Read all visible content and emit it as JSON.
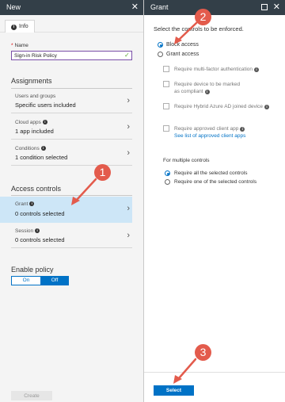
{
  "left_panel": {
    "title": "New",
    "close_glyph": "✕",
    "info_tab": "Info",
    "name_label": "Name",
    "required_mark": "*",
    "name_value": "Sign-in Risk Policy",
    "assignments_title": "Assignments",
    "rows": [
      {
        "label": "Users and groups",
        "value": "Specific users included"
      },
      {
        "label": "Cloud apps",
        "value": "1 app included"
      },
      {
        "label": "Conditions",
        "value": "1 condition selected"
      }
    ],
    "access_title": "Access controls",
    "grant": {
      "label": "Grant",
      "value": "0 controls selected"
    },
    "session": {
      "label": "Session",
      "value": "0 controls selected"
    },
    "enable_title": "Enable policy",
    "toggle": {
      "on": "On",
      "off": "Off",
      "selected": "Off"
    },
    "create_label": "Create"
  },
  "right_panel": {
    "title": "Grant",
    "close_glyph": "✕",
    "instruction": "Select the controls to be enforced.",
    "options": [
      {
        "label": "Block access",
        "selected": true
      },
      {
        "label": "Grant access",
        "selected": false
      }
    ],
    "controls": [
      {
        "label": "Require multi-factor authentication"
      },
      {
        "label": "Require device to be marked as compliant"
      },
      {
        "label": "Require Hybrid Azure AD joined device"
      },
      {
        "label": "Require approved client app"
      }
    ],
    "approved_link": "See list of approved client apps",
    "multi_title": "For multiple controls",
    "multi_options": [
      {
        "label": "Require all the selected controls",
        "selected": true
      },
      {
        "label": "Require one of the selected controls",
        "selected": false
      }
    ],
    "select_label": "Select"
  },
  "annotations": [
    "1",
    "2",
    "3"
  ],
  "colors": {
    "header": "#333f48",
    "accent": "#0072c6",
    "highlight": "#cde6f7",
    "badge": "#e35b4c"
  }
}
